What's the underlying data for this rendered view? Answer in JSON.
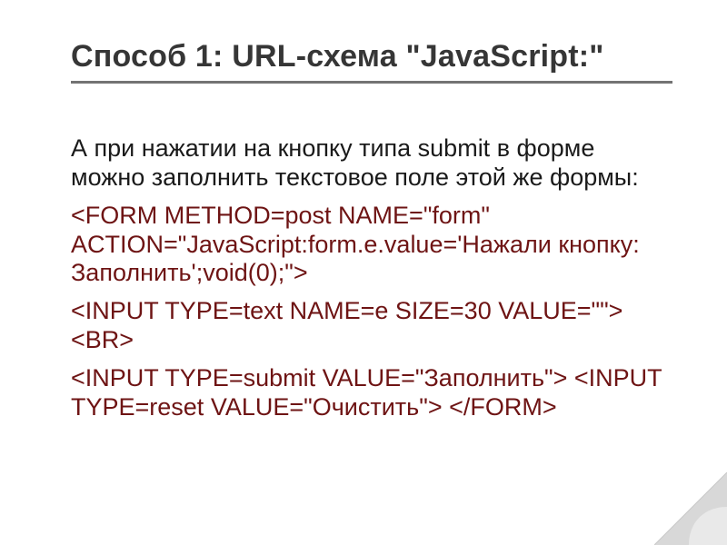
{
  "title": "Способ 1: URL-схема \"JavaScript:\"",
  "paragraphs": {
    "intro": "А при нажатии на кнопку типа submit в форме можно заполнить текстовое поле этой же формы:",
    "code1": "<FORM METHOD=post NAME=\"form\" ACTION=\"JavaScript:form.e.value='Нажали кнопку: Заполнить';void(0);\">",
    "code2": " <INPUT TYPE=text NAME=e SIZE=30 VALUE=\"\"><BR>",
    "code3": "<INPUT TYPE=submit VALUE=\"Заполнить\"> <INPUT TYPE=reset VALUE=\"Очистить\"> </FORM>"
  }
}
